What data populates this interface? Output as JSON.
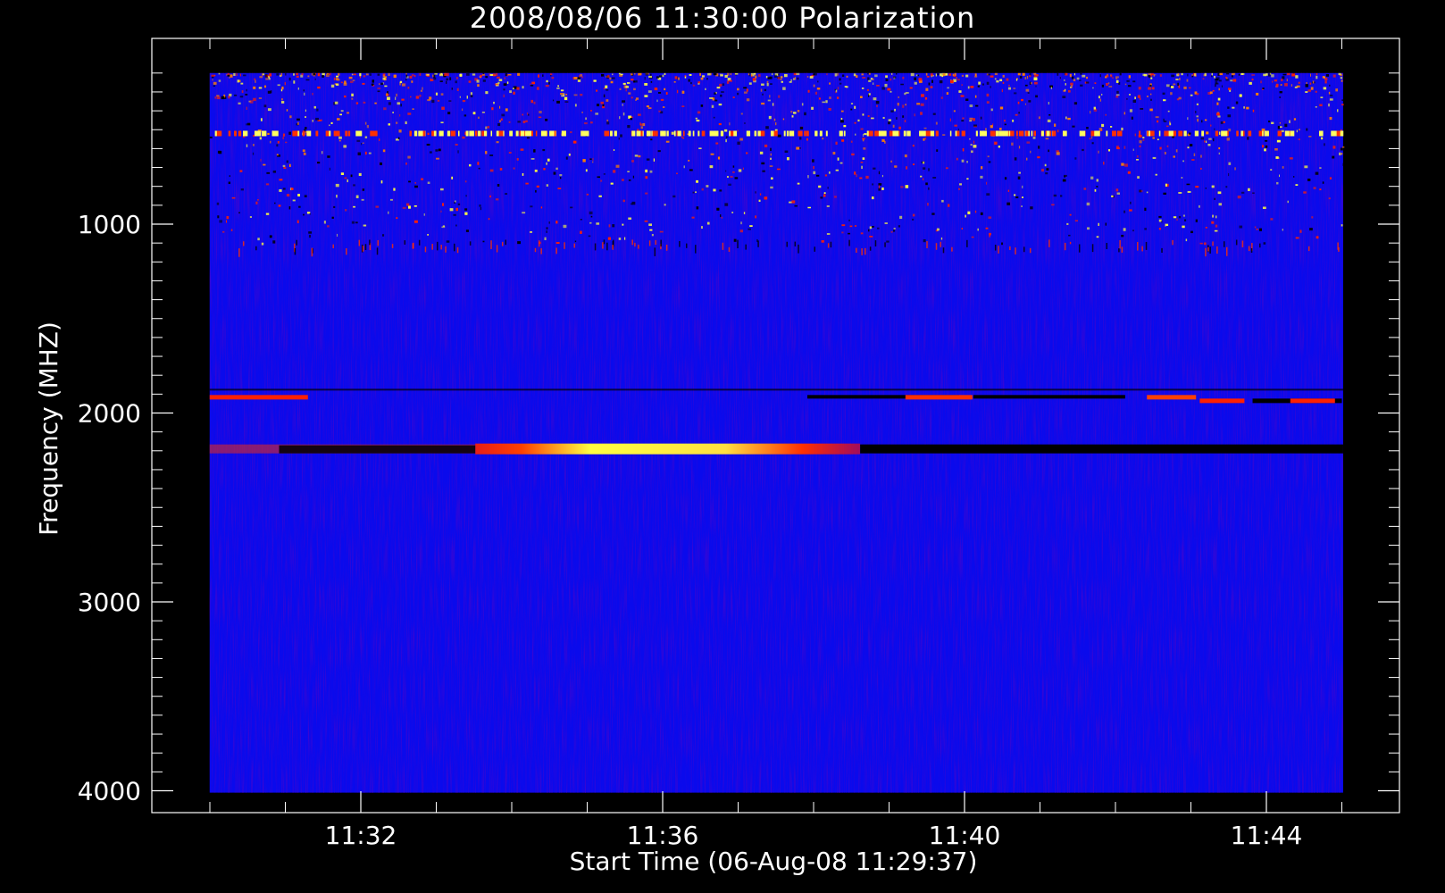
{
  "chart_data": {
    "type": "heatmap",
    "title": "2008/08/06 11:30:00 Polarization",
    "xlabel": "Start Time (06-Aug-08 11:29:37)",
    "ylabel": "Frequency (MHZ)",
    "x_ticks": [
      "11:32",
      "11:36",
      "11:40",
      "11:44"
    ],
    "x_tick_minutes": [
      2.383,
      6.383,
      10.383,
      14.383
    ],
    "y_ticks": [
      1000,
      2000,
      3000,
      4000
    ],
    "ylim_mhz": [
      100,
      4100
    ],
    "xlim_minutes": [
      0,
      16.5
    ],
    "data_time_range_minutes": [
      0.38,
      15.4
    ],
    "data_freq_range_mhz": [
      200,
      4010
    ],
    "y_inverted": true,
    "colormap": [
      "#000000",
      "#1010ff",
      "#ff2000",
      "#ffff40"
    ],
    "background_color": "#0a0aec",
    "features": [
      {
        "name": "bright interference band",
        "freq_mhz": 520,
        "t_start": 0.38,
        "t_end": 15.4,
        "intensity": "high"
      },
      {
        "name": "narrow streaks",
        "freq_mhz": 1110,
        "t_start": 0.38,
        "t_end": 15.4,
        "intensity": "medium"
      },
      {
        "name": "band near 1900 MHz",
        "freq_mhz": 1900,
        "t_start": 0.38,
        "t_end": 15.4,
        "intensity": "mixed"
      },
      {
        "name": "polarized emission band",
        "freq_mhz": 2190,
        "t_start": 3.9,
        "t_end": 9.0,
        "intensity": "very high"
      },
      {
        "name": "negative polarization band",
        "freq_mhz": 2190,
        "t_start": 9.0,
        "t_end": 15.4,
        "intensity": "low"
      }
    ]
  }
}
